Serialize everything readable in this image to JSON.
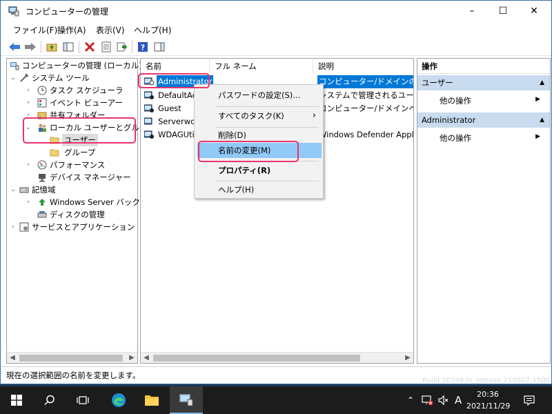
{
  "window": {
    "title": "コンピューターの管理"
  },
  "menu": [
    "ファイル(F)",
    "操作(A)",
    "表示(V)",
    "ヘルプ(H)"
  ],
  "tree": {
    "root": "コンピューターの管理 (ローカル)",
    "system_tools": "システム ツール",
    "task_scheduler": "タスク スケジューラ",
    "event_viewer": "イベント ビューアー",
    "shared_folders": "共有フォルダー",
    "local_users_groups": "ローカル ユーザーとグループ",
    "users": "ユーザー",
    "groups": "グループ",
    "performance": "パフォーマンス",
    "device_manager": "デバイス マネージャー",
    "storage": "記憶域",
    "windows_server_backup": "Windows Server バックア",
    "disk_management": "ディスクの管理",
    "services_apps": "サービスとアプリケーション"
  },
  "columns": {
    "name": "名前",
    "fullname": "フル ネーム",
    "description": "説明"
  },
  "users": [
    {
      "name": "Administrator",
      "description": "コンピューター/ドメインの管理用"
    },
    {
      "name": "DefaultAcc",
      "description": "システムで管理されるユーザー"
    },
    {
      "name": "Guest",
      "description": "コンピューター/ドメインへのゲスト"
    },
    {
      "name": "Serverworl",
      "description": ""
    },
    {
      "name": "WDAGUtili",
      "description": "Windows Defender Applic"
    }
  ],
  "context_menu": {
    "set_password": "パスワードの設定(S)...",
    "all_tasks": "すべてのタスク(K)",
    "delete": "削除(D)",
    "rename": "名前の変更(M)",
    "properties": "プロパティ(R)",
    "help": "ヘルプ(H)"
  },
  "actions": {
    "title": "操作",
    "section1": "ユーザー",
    "other_ops_1": "他の操作",
    "section2": "Administrator",
    "other_ops_2": "他の操作"
  },
  "status": "現在の選択範囲の名前を変更します。",
  "build_text": "Build 20348.fe_release.210507-1500",
  "taskbar": {
    "time": "20:36",
    "date": "2021/11/29",
    "ime": "A"
  },
  "colors": {
    "highlight_box": "#e8336a",
    "selection": "#0078d7",
    "menu_hover": "#91c9f7"
  }
}
